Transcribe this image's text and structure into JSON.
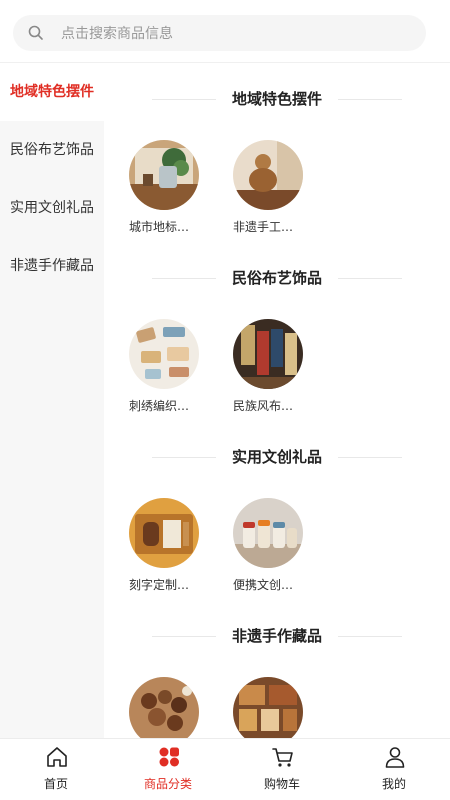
{
  "search": {
    "placeholder": "点击搜索商品信息",
    "value": ""
  },
  "sidebar": {
    "items": [
      {
        "label": "地域特色摆件",
        "active": true
      },
      {
        "label": "民俗布艺饰品",
        "active": false
      },
      {
        "label": "实用文创礼品",
        "active": false
      },
      {
        "label": "非遗手作藏品",
        "active": false
      }
    ]
  },
  "sections": [
    {
      "title": "地域特色摆件",
      "products": [
        {
          "name": "城市地标…",
          "image": "landmark-ornament"
        },
        {
          "name": "非遗手工…",
          "image": "handcraft-figurine"
        }
      ]
    },
    {
      "title": "民俗布艺饰品",
      "products": [
        {
          "name": "刺绣编织…",
          "image": "embroidery-items"
        },
        {
          "name": "民族风布…",
          "image": "ethnic-fabric"
        }
      ]
    },
    {
      "title": "实用文创礼品",
      "products": [
        {
          "name": "刻字定制…",
          "image": "engraved-gift"
        },
        {
          "name": "便携文创…",
          "image": "portable-jars"
        }
      ]
    },
    {
      "title": "非遗手作藏品",
      "products": [
        {
          "name": "",
          "image": "wooden-beads"
        },
        {
          "name": "",
          "image": "collectibles-shelf"
        }
      ]
    }
  ],
  "tabbar": {
    "items": [
      {
        "label": "首页",
        "icon": "home-icon",
        "active": false
      },
      {
        "label": "商品分类",
        "icon": "category-icon",
        "active": true
      },
      {
        "label": "购物车",
        "icon": "cart-icon",
        "active": false
      },
      {
        "label": "我的",
        "icon": "user-icon",
        "active": false
      }
    ]
  },
  "colors": {
    "accent": "#e02e24",
    "sidebar_bg": "#f7f7f7",
    "search_bg": "#f5f5f5"
  }
}
